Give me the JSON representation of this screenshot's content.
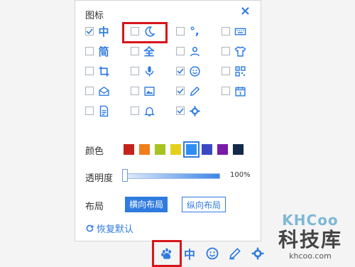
{
  "panel": {
    "title": "图标",
    "close": "×",
    "icons": [
      {
        "name": "lang-zh-icon",
        "glyph": "中",
        "checked": true
      },
      {
        "name": "moon-icon",
        "glyph": "",
        "checked": false
      },
      {
        "name": "punctuation-icon",
        "glyph": "°,",
        "checked": false
      },
      {
        "name": "keyboard-icon",
        "glyph": "",
        "checked": false
      },
      {
        "name": "simplified-icon",
        "glyph": "简",
        "checked": false
      },
      {
        "name": "fullwidth-icon",
        "glyph": "全",
        "checked": false
      },
      {
        "name": "user-icon",
        "glyph": "",
        "checked": false
      },
      {
        "name": "skin-shirt-icon",
        "glyph": "",
        "checked": false
      },
      {
        "name": "crop-icon",
        "glyph": "",
        "checked": false
      },
      {
        "name": "mic-icon",
        "glyph": "",
        "checked": false
      },
      {
        "name": "emoji-icon",
        "glyph": "",
        "checked": true
      },
      {
        "name": "qrcode-icon",
        "glyph": "",
        "checked": false
      },
      {
        "name": "mail-icon",
        "glyph": "",
        "checked": false
      },
      {
        "name": "image-icon",
        "glyph": "",
        "checked": false
      },
      {
        "name": "pen-icon",
        "glyph": "",
        "checked": true
      },
      {
        "name": "calendar-icon",
        "glyph": "1",
        "checked": false
      },
      {
        "name": "document-icon",
        "glyph": "",
        "checked": false
      },
      {
        "name": "bell-icon",
        "glyph": "",
        "checked": false
      },
      {
        "name": "settings-gear-icon",
        "glyph": "",
        "checked": true
      }
    ],
    "color_label": "颜色",
    "colors": [
      "#c5221a",
      "#f07e1a",
      "#a8c220",
      "#e5cf1c",
      "#2f8ef0",
      "#3a48c4",
      "#7a1aa6",
      "#142a4a"
    ],
    "selected_color_index": 4,
    "opacity_label": "透明度",
    "opacity_value": "100%",
    "opacity_fraction": 1.0,
    "layout_label": "布局",
    "layout_horizontal": "横向布局",
    "layout_vertical": "纵向布局",
    "restore_label": "恢复默认"
  },
  "toolbar": {
    "items": [
      "paw-icon",
      "中",
      "emoji-icon",
      "pen-icon",
      "settings-gear-icon"
    ],
    "zh_label": "中"
  },
  "watermark": {
    "logo": "KHCoo",
    "cn": "科技库",
    "url": "khcoo.com"
  },
  "colors": {
    "accent": "#2f7be0",
    "highlight": "#d6161b"
  }
}
